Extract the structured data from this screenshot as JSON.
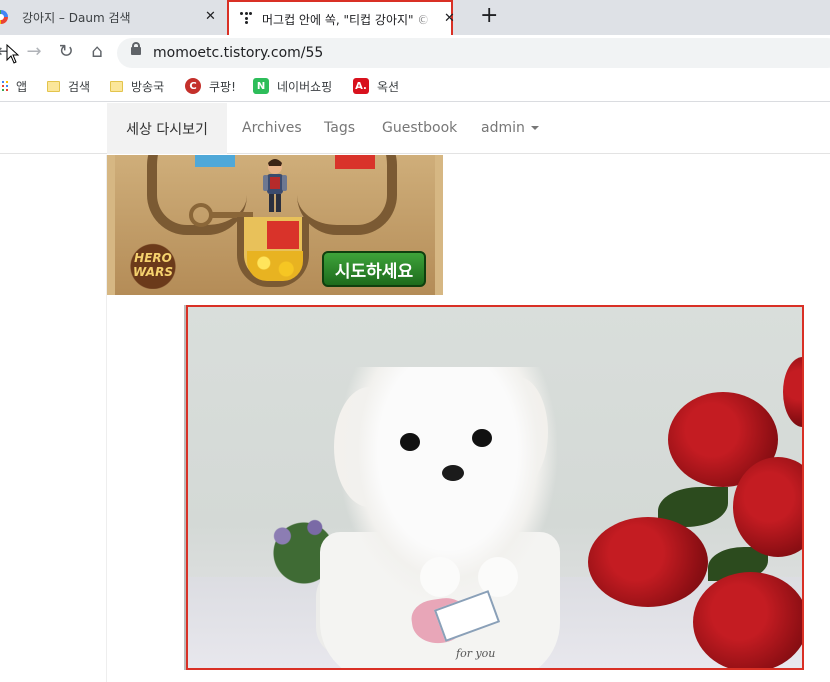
{
  "browser": {
    "tabs": [
      {
        "title": "강아지 – Daum 검색",
        "close": "✕",
        "active": false
      },
      {
        "title": "머그컵 안에 쏙, \"티컵 강아지\" ©",
        "close": "✕",
        "active": true
      }
    ],
    "new_tab": "+",
    "url": "momoetc.tistory.com/55",
    "nav": {
      "back": "←",
      "forward": "→",
      "reload": "↻",
      "home": "⌂"
    }
  },
  "bookmarks": [
    {
      "label": "앱",
      "icon": "apps-grid-icon"
    },
    {
      "label": "검색",
      "icon": "folder-icon"
    },
    {
      "label": "방송국",
      "icon": "folder-icon"
    },
    {
      "label": "쿠팡!",
      "icon": "coupang-icon",
      "glyph": "C"
    },
    {
      "label": "네이버쇼핑",
      "icon": "naver-shopping-icon",
      "glyph": "N"
    },
    {
      "label": "옥션",
      "icon": "auction-icon",
      "glyph": "A."
    }
  ],
  "site": {
    "brand": "세상 다시보기",
    "nav": [
      "Archives",
      "Tags",
      "Guestbook",
      "admin"
    ]
  },
  "ad": {
    "logo": "HERO WARS",
    "cta": "시도하세요"
  },
  "photo": {
    "cup_text": "for you"
  },
  "colors": {
    "highlight": "#d93025",
    "tab_strip": "#dee1e6",
    "nav_brand_bg": "#f2f2f2",
    "cta_green": "#2c8a2a"
  }
}
